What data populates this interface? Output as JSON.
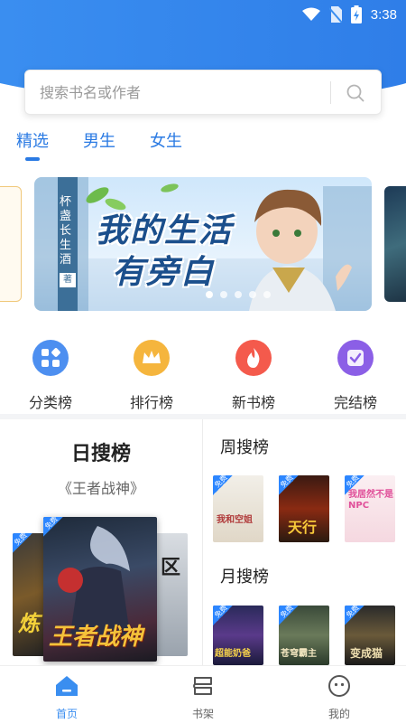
{
  "colors": {
    "accent": "#2a7ae3",
    "header": "#3a8ef0"
  },
  "status_bar": {
    "time": "3:38",
    "icons": [
      "wifi-icon",
      "no-sim-icon",
      "battery-charging-icon"
    ]
  },
  "search": {
    "placeholder": "搜索书名或作者",
    "value": ""
  },
  "tabs": [
    {
      "label": "精选",
      "active": true
    },
    {
      "label": "男生",
      "active": false
    },
    {
      "label": "女生",
      "active": false
    }
  ],
  "banner": {
    "title_line1": "我的生活",
    "title_line2": "有旁白",
    "author": "杯盏长生酒",
    "author_suffix": "著",
    "dots_count": 5,
    "active_dot": 0
  },
  "categories": [
    {
      "label": "分类榜",
      "icon": "grid-icon",
      "color": "#4d8ff0"
    },
    {
      "label": "排行榜",
      "icon": "crown-icon",
      "color": "#f5b53d"
    },
    {
      "label": "新书榜",
      "icon": "flame-icon",
      "color": "#f45a4c"
    },
    {
      "label": "完结榜",
      "icon": "check-badge-icon",
      "color": "#8b5fe6"
    }
  ],
  "daily": {
    "title": "日搜榜",
    "subtitle": "《王者战神》",
    "books": [
      {
        "title": "王者战神",
        "free": "免费"
      },
      {
        "title": "炼",
        "free": "免费"
      },
      {
        "title": "区",
        "free": ""
      }
    ]
  },
  "weekly": {
    "title": "周搜榜",
    "books": [
      {
        "title": "我和空姐",
        "free": "免费"
      },
      {
        "title": "天行",
        "free": "免费"
      },
      {
        "title": "我居然不是NPC",
        "free": "免费"
      }
    ]
  },
  "monthly": {
    "title": "月搜榜",
    "books": [
      {
        "title": "超能奶爸",
        "free": "免费"
      },
      {
        "title": "苍穹霸主",
        "free": "免费"
      },
      {
        "title": "变成猫",
        "free": "免费"
      }
    ]
  },
  "bottom_nav": [
    {
      "label": "首页",
      "icon": "home-icon",
      "active": true
    },
    {
      "label": "书架",
      "icon": "bookshelf-icon",
      "active": false
    },
    {
      "label": "我的",
      "icon": "profile-icon",
      "active": false
    }
  ]
}
